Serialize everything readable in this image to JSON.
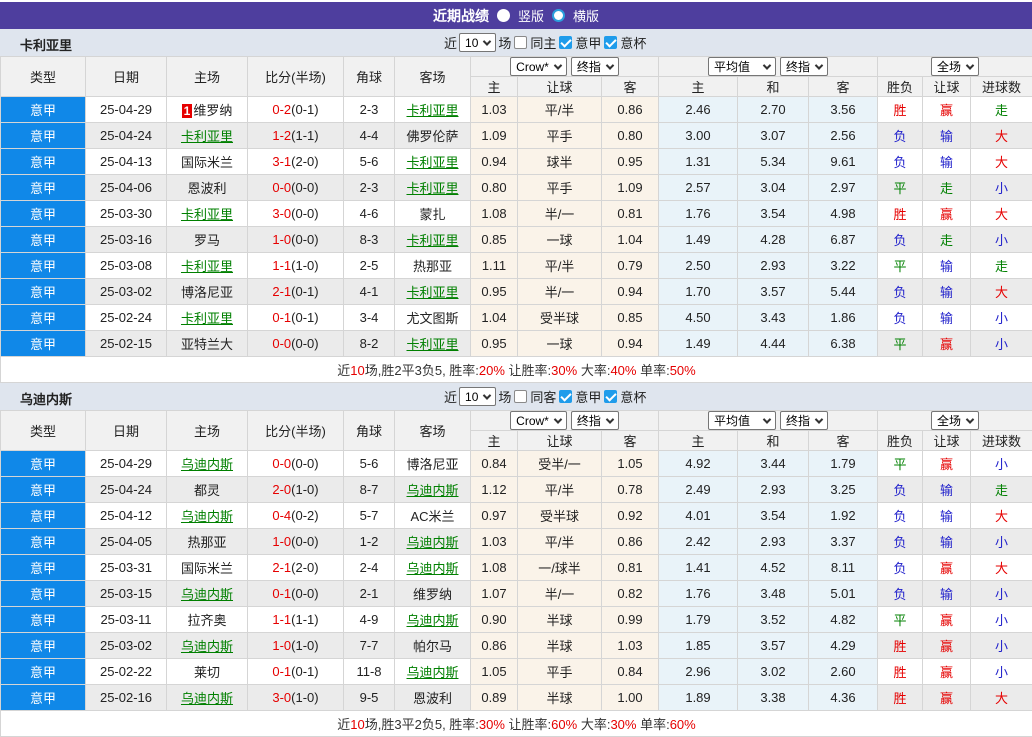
{
  "titlebar": {
    "title": "近期战绩",
    "radio_vertical_label": "竖版",
    "radio_horizontal_label": "横版"
  },
  "controls": {
    "count_value": "10",
    "near_label": "近",
    "games_label": "场",
    "league_label": "意甲",
    "cup_label": "意杯",
    "bookmaker_select": "Crow*",
    "final_select": "终指",
    "average_select": "平均值",
    "final_select2": "终指",
    "scope_select": "全场"
  },
  "columns": {
    "type": "类型",
    "date": "日期",
    "home": "主场",
    "score": "比分(半场)",
    "corner": "角球",
    "away": "客场",
    "odds_home": "主",
    "handicap": "让球",
    "odds_away": "客",
    "avg_home": "主",
    "avg_draw": "和",
    "avg_away": "客",
    "result": "胜负",
    "handicap_result": "让球",
    "goals": "进球数"
  },
  "colors": {
    "accent_purple": "#4e3e9e",
    "league_blue": "#1088e8",
    "link_green": "#008000",
    "red": "#e60000",
    "blue": "#2222cc"
  },
  "sections": [
    {
      "team": "卡利亚里",
      "venue_filter_label": "同主",
      "rows": [
        {
          "league": "意甲",
          "date": "25-04-29",
          "home": "维罗纳",
          "home_focus": false,
          "home_badge": "1",
          "score": "0-2",
          "half": "(0-1)",
          "corner": "2-3",
          "away": "卡利亚里",
          "away_focus": true,
          "crow_home": "1.03",
          "handicap": "平/半",
          "crow_away": "0.86",
          "avg_home": "2.46",
          "avg_draw": "2.70",
          "avg_away": "3.56",
          "result": "胜",
          "handicap_result": "赢",
          "goals": "走"
        },
        {
          "league": "意甲",
          "date": "25-04-24",
          "home": "卡利亚里",
          "home_focus": true,
          "home_badge": "",
          "score": "1-2",
          "half": "(1-1)",
          "corner": "4-4",
          "away": "佛罗伦萨",
          "away_focus": false,
          "crow_home": "1.09",
          "handicap": "平手",
          "crow_away": "0.80",
          "avg_home": "3.00",
          "avg_draw": "3.07",
          "avg_away": "2.56",
          "result": "负",
          "handicap_result": "输",
          "goals": "大"
        },
        {
          "league": "意甲",
          "date": "25-04-13",
          "home": "国际米兰",
          "home_focus": false,
          "home_badge": "",
          "score": "3-1",
          "half": "(2-0)",
          "corner": "5-6",
          "away": "卡利亚里",
          "away_focus": true,
          "crow_home": "0.94",
          "handicap": "球半",
          "crow_away": "0.95",
          "avg_home": "1.31",
          "avg_draw": "5.34",
          "avg_away": "9.61",
          "result": "负",
          "handicap_result": "输",
          "goals": "大"
        },
        {
          "league": "意甲",
          "date": "25-04-06",
          "home": "恩波利",
          "home_focus": false,
          "home_badge": "",
          "score": "0-0",
          "half": "(0-0)",
          "corner": "2-3",
          "away": "卡利亚里",
          "away_focus": true,
          "crow_home": "0.80",
          "handicap": "平手",
          "crow_away": "1.09",
          "avg_home": "2.57",
          "avg_draw": "3.04",
          "avg_away": "2.97",
          "result": "平",
          "handicap_result": "走",
          "goals": "小"
        },
        {
          "league": "意甲",
          "date": "25-03-30",
          "home": "卡利亚里",
          "home_focus": true,
          "home_badge": "",
          "score": "3-0",
          "half": "(0-0)",
          "corner": "4-6",
          "away": "蒙扎",
          "away_focus": false,
          "crow_home": "1.08",
          "handicap": "半/一",
          "crow_away": "0.81",
          "avg_home": "1.76",
          "avg_draw": "3.54",
          "avg_away": "4.98",
          "result": "胜",
          "handicap_result": "赢",
          "goals": "大"
        },
        {
          "league": "意甲",
          "date": "25-03-16",
          "home": "罗马",
          "home_focus": false,
          "home_badge": "",
          "score": "1-0",
          "half": "(0-0)",
          "corner": "8-3",
          "away": "卡利亚里",
          "away_focus": true,
          "crow_home": "0.85",
          "handicap": "一球",
          "crow_away": "1.04",
          "avg_home": "1.49",
          "avg_draw": "4.28",
          "avg_away": "6.87",
          "result": "负",
          "handicap_result": "走",
          "goals": "小"
        },
        {
          "league": "意甲",
          "date": "25-03-08",
          "home": "卡利亚里",
          "home_focus": true,
          "home_badge": "",
          "score": "1-1",
          "half": "(1-0)",
          "corner": "2-5",
          "away": "热那亚",
          "away_focus": false,
          "crow_home": "1.11",
          "handicap": "平/半",
          "crow_away": "0.79",
          "avg_home": "2.50",
          "avg_draw": "2.93",
          "avg_away": "3.22",
          "result": "平",
          "handicap_result": "输",
          "goals": "走"
        },
        {
          "league": "意甲",
          "date": "25-03-02",
          "home": "博洛尼亚",
          "home_focus": false,
          "home_badge": "",
          "score": "2-1",
          "half": "(0-1)",
          "corner": "4-1",
          "away": "卡利亚里",
          "away_focus": true,
          "crow_home": "0.95",
          "handicap": "半/一",
          "crow_away": "0.94",
          "avg_home": "1.70",
          "avg_draw": "3.57",
          "avg_away": "5.44",
          "result": "负",
          "handicap_result": "输",
          "goals": "大"
        },
        {
          "league": "意甲",
          "date": "25-02-24",
          "home": "卡利亚里",
          "home_focus": true,
          "home_badge": "",
          "score": "0-1",
          "half": "(0-1)",
          "corner": "3-4",
          "away": "尤文图斯",
          "away_focus": false,
          "crow_home": "1.04",
          "handicap": "受半球",
          "crow_away": "0.85",
          "avg_home": "4.50",
          "avg_draw": "3.43",
          "avg_away": "1.86",
          "result": "负",
          "handicap_result": "输",
          "goals": "小"
        },
        {
          "league": "意甲",
          "date": "25-02-15",
          "home": "亚特兰大",
          "home_focus": false,
          "home_badge": "",
          "score": "0-0",
          "half": "(0-0)",
          "corner": "8-2",
          "away": "卡利亚里",
          "away_focus": true,
          "crow_home": "0.95",
          "handicap": "一球",
          "crow_away": "0.94",
          "avg_home": "1.49",
          "avg_draw": "4.44",
          "avg_away": "6.38",
          "result": "平",
          "handicap_result": "赢",
          "goals": "小"
        }
      ],
      "summary": [
        {
          "text": "近",
          "color": "k"
        },
        {
          "text": "10",
          "color": "r"
        },
        {
          "text": "场,胜2平3负5, 胜率:",
          "color": "k"
        },
        {
          "text": "20%",
          "color": "r"
        },
        {
          "text": " 让胜率:",
          "color": "k"
        },
        {
          "text": "30%",
          "color": "r"
        },
        {
          "text": " 大率:",
          "color": "k"
        },
        {
          "text": "40%",
          "color": "r"
        },
        {
          "text": " 单率:",
          "color": "k"
        },
        {
          "text": "50%",
          "color": "r"
        }
      ]
    },
    {
      "team": "乌迪内斯",
      "venue_filter_label": "同客",
      "rows": [
        {
          "league": "意甲",
          "date": "25-04-29",
          "home": "乌迪内斯",
          "home_focus": true,
          "home_badge": "",
          "score": "0-0",
          "half": "(0-0)",
          "corner": "5-6",
          "away": "博洛尼亚",
          "away_focus": false,
          "crow_home": "0.84",
          "handicap": "受半/一",
          "crow_away": "1.05",
          "avg_home": "4.92",
          "avg_draw": "3.44",
          "avg_away": "1.79",
          "result": "平",
          "handicap_result": "赢",
          "goals": "小"
        },
        {
          "league": "意甲",
          "date": "25-04-24",
          "home": "都灵",
          "home_focus": false,
          "home_badge": "",
          "score": "2-0",
          "half": "(1-0)",
          "corner": "8-7",
          "away": "乌迪内斯",
          "away_focus": true,
          "crow_home": "1.12",
          "handicap": "平/半",
          "crow_away": "0.78",
          "avg_home": "2.49",
          "avg_draw": "2.93",
          "avg_away": "3.25",
          "result": "负",
          "handicap_result": "输",
          "goals": "走"
        },
        {
          "league": "意甲",
          "date": "25-04-12",
          "home": "乌迪内斯",
          "home_focus": true,
          "home_badge": "",
          "score": "0-4",
          "half": "(0-2)",
          "corner": "5-7",
          "away": "AC米兰",
          "away_focus": false,
          "crow_home": "0.97",
          "handicap": "受半球",
          "crow_away": "0.92",
          "avg_home": "4.01",
          "avg_draw": "3.54",
          "avg_away": "1.92",
          "result": "负",
          "handicap_result": "输",
          "goals": "大"
        },
        {
          "league": "意甲",
          "date": "25-04-05",
          "home": "热那亚",
          "home_focus": false,
          "home_badge": "",
          "score": "1-0",
          "half": "(0-0)",
          "corner": "1-2",
          "away": "乌迪内斯",
          "away_focus": true,
          "crow_home": "1.03",
          "handicap": "平/半",
          "crow_away": "0.86",
          "avg_home": "2.42",
          "avg_draw": "2.93",
          "avg_away": "3.37",
          "result": "负",
          "handicap_result": "输",
          "goals": "小"
        },
        {
          "league": "意甲",
          "date": "25-03-31",
          "home": "国际米兰",
          "home_focus": false,
          "home_badge": "",
          "score": "2-1",
          "half": "(2-0)",
          "corner": "2-4",
          "away": "乌迪内斯",
          "away_focus": true,
          "crow_home": "1.08",
          "handicap": "一/球半",
          "crow_away": "0.81",
          "avg_home": "1.41",
          "avg_draw": "4.52",
          "avg_away": "8.11",
          "result": "负",
          "handicap_result": "赢",
          "goals": "大"
        },
        {
          "league": "意甲",
          "date": "25-03-15",
          "home": "乌迪内斯",
          "home_focus": true,
          "home_badge": "",
          "score": "0-1",
          "half": "(0-0)",
          "corner": "2-1",
          "away": "维罗纳",
          "away_focus": false,
          "crow_home": "1.07",
          "handicap": "半/一",
          "crow_away": "0.82",
          "avg_home": "1.76",
          "avg_draw": "3.48",
          "avg_away": "5.01",
          "result": "负",
          "handicap_result": "输",
          "goals": "小"
        },
        {
          "league": "意甲",
          "date": "25-03-11",
          "home": "拉齐奥",
          "home_focus": false,
          "home_badge": "",
          "score": "1-1",
          "half": "(1-1)",
          "corner": "4-9",
          "away": "乌迪内斯",
          "away_focus": true,
          "crow_home": "0.90",
          "handicap": "半球",
          "crow_away": "0.99",
          "avg_home": "1.79",
          "avg_draw": "3.52",
          "avg_away": "4.82",
          "result": "平",
          "handicap_result": "赢",
          "goals": "小"
        },
        {
          "league": "意甲",
          "date": "25-03-02",
          "home": "乌迪内斯",
          "home_focus": true,
          "home_badge": "",
          "score": "1-0",
          "half": "(1-0)",
          "corner": "7-7",
          "away": "帕尔马",
          "away_focus": false,
          "crow_home": "0.86",
          "handicap": "半球",
          "crow_away": "1.03",
          "avg_home": "1.85",
          "avg_draw": "3.57",
          "avg_away": "4.29",
          "result": "胜",
          "handicap_result": "赢",
          "goals": "小"
        },
        {
          "league": "意甲",
          "date": "25-02-22",
          "home": "莱切",
          "home_focus": false,
          "home_badge": "",
          "score": "0-1",
          "half": "(0-1)",
          "corner": "11-8",
          "away": "乌迪内斯",
          "away_focus": true,
          "crow_home": "1.05",
          "handicap": "平手",
          "crow_away": "0.84",
          "avg_home": "2.96",
          "avg_draw": "3.02",
          "avg_away": "2.60",
          "result": "胜",
          "handicap_result": "赢",
          "goals": "小"
        },
        {
          "league": "意甲",
          "date": "25-02-16",
          "home": "乌迪内斯",
          "home_focus": true,
          "home_badge": "",
          "score": "3-0",
          "half": "(1-0)",
          "corner": "9-5",
          "away": "恩波利",
          "away_focus": false,
          "crow_home": "0.89",
          "handicap": "半球",
          "crow_away": "1.00",
          "avg_home": "1.89",
          "avg_draw": "3.38",
          "avg_away": "4.36",
          "result": "胜",
          "handicap_result": "赢",
          "goals": "大"
        }
      ],
      "summary": [
        {
          "text": "近",
          "color": "k"
        },
        {
          "text": "10",
          "color": "r"
        },
        {
          "text": "场,胜3平2负5, 胜率:",
          "color": "k"
        },
        {
          "text": "30%",
          "color": "r"
        },
        {
          "text": " 让胜率:",
          "color": "k"
        },
        {
          "text": "60%",
          "color": "r"
        },
        {
          "text": " 大率:",
          "color": "k"
        },
        {
          "text": "30%",
          "color": "r"
        },
        {
          "text": " 单率:",
          "color": "k"
        },
        {
          "text": "60%",
          "color": "r"
        }
      ]
    }
  ]
}
